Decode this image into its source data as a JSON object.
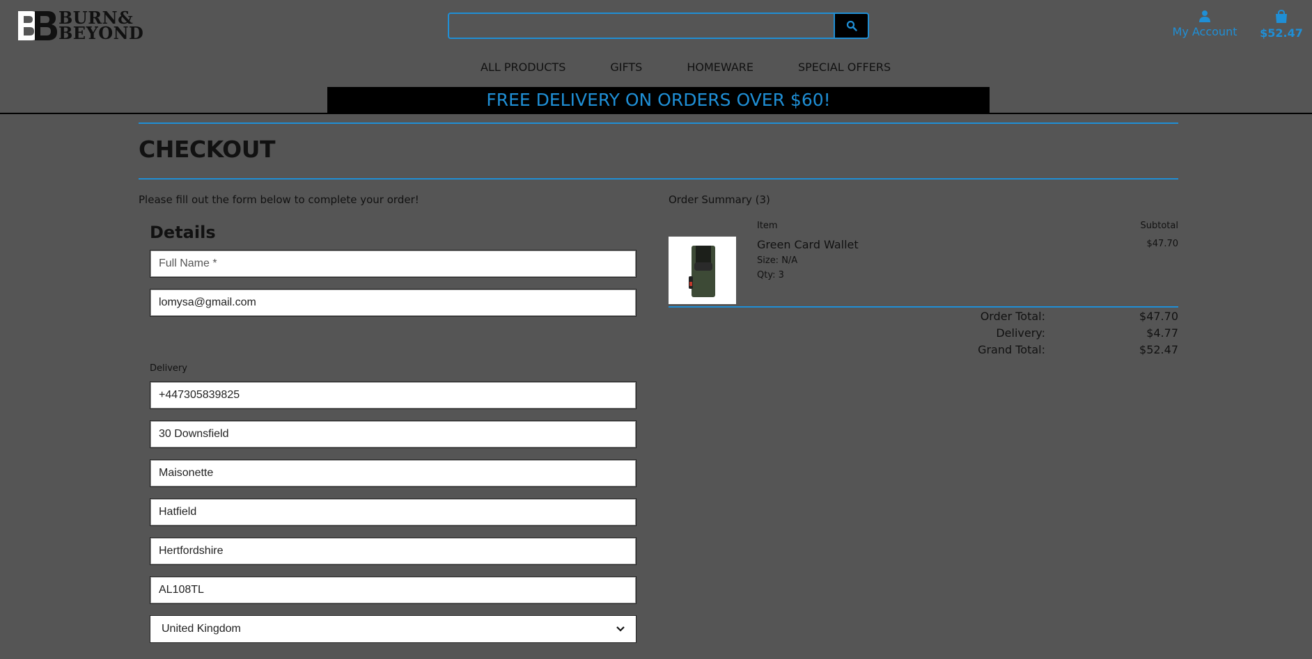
{
  "header": {
    "logo_text_line1": "BURN&",
    "logo_text_line2": "BEYOND",
    "search_placeholder": "",
    "account_label": "My Account",
    "cart_total": "$52.47"
  },
  "nav": {
    "items": [
      "ALL PRODUCTS",
      "GIFTS",
      "HOMEWARE",
      "SPECIAL OFFERS"
    ]
  },
  "banner": {
    "text": "FREE DELIVERY ON ORDERS OVER $60!"
  },
  "checkout": {
    "title": "CHECKOUT",
    "intro": "Please fill out the form below to complete your order!",
    "details_title": "Details",
    "full_name_placeholder": "Full Name *",
    "email_value": "lomysa@gmail.com",
    "delivery_label": "Delivery",
    "phone_value": "+447305839825",
    "street1_value": "30 Downsfield",
    "street2_value": "Maisonette",
    "town_value": "Hatfield",
    "county_value": "Hertfordshire",
    "postcode_value": "AL108TL",
    "country_value": "United Kingdom"
  },
  "summary": {
    "title": "Order Summary (3)",
    "col_item": "Item",
    "col_subtotal": "Subtotal",
    "product": {
      "name": "Green Card Wallet",
      "size": "Size: N/A",
      "qty": "Qty: 3",
      "price": "$47.70"
    },
    "order_total_label": "Order Total:",
    "order_total_value": "$47.70",
    "delivery_label": "Delivery:",
    "delivery_value": "$4.77",
    "grand_total_label": "Grand Total:",
    "grand_total_value": "$52.47"
  },
  "colors": {
    "accent": "#1f8fd6",
    "background": "#555555",
    "banner_bg": "#000000"
  },
  "icons": [
    "search-icon",
    "user-icon",
    "shopping-bag-icon",
    "chevron-down-icon"
  ]
}
